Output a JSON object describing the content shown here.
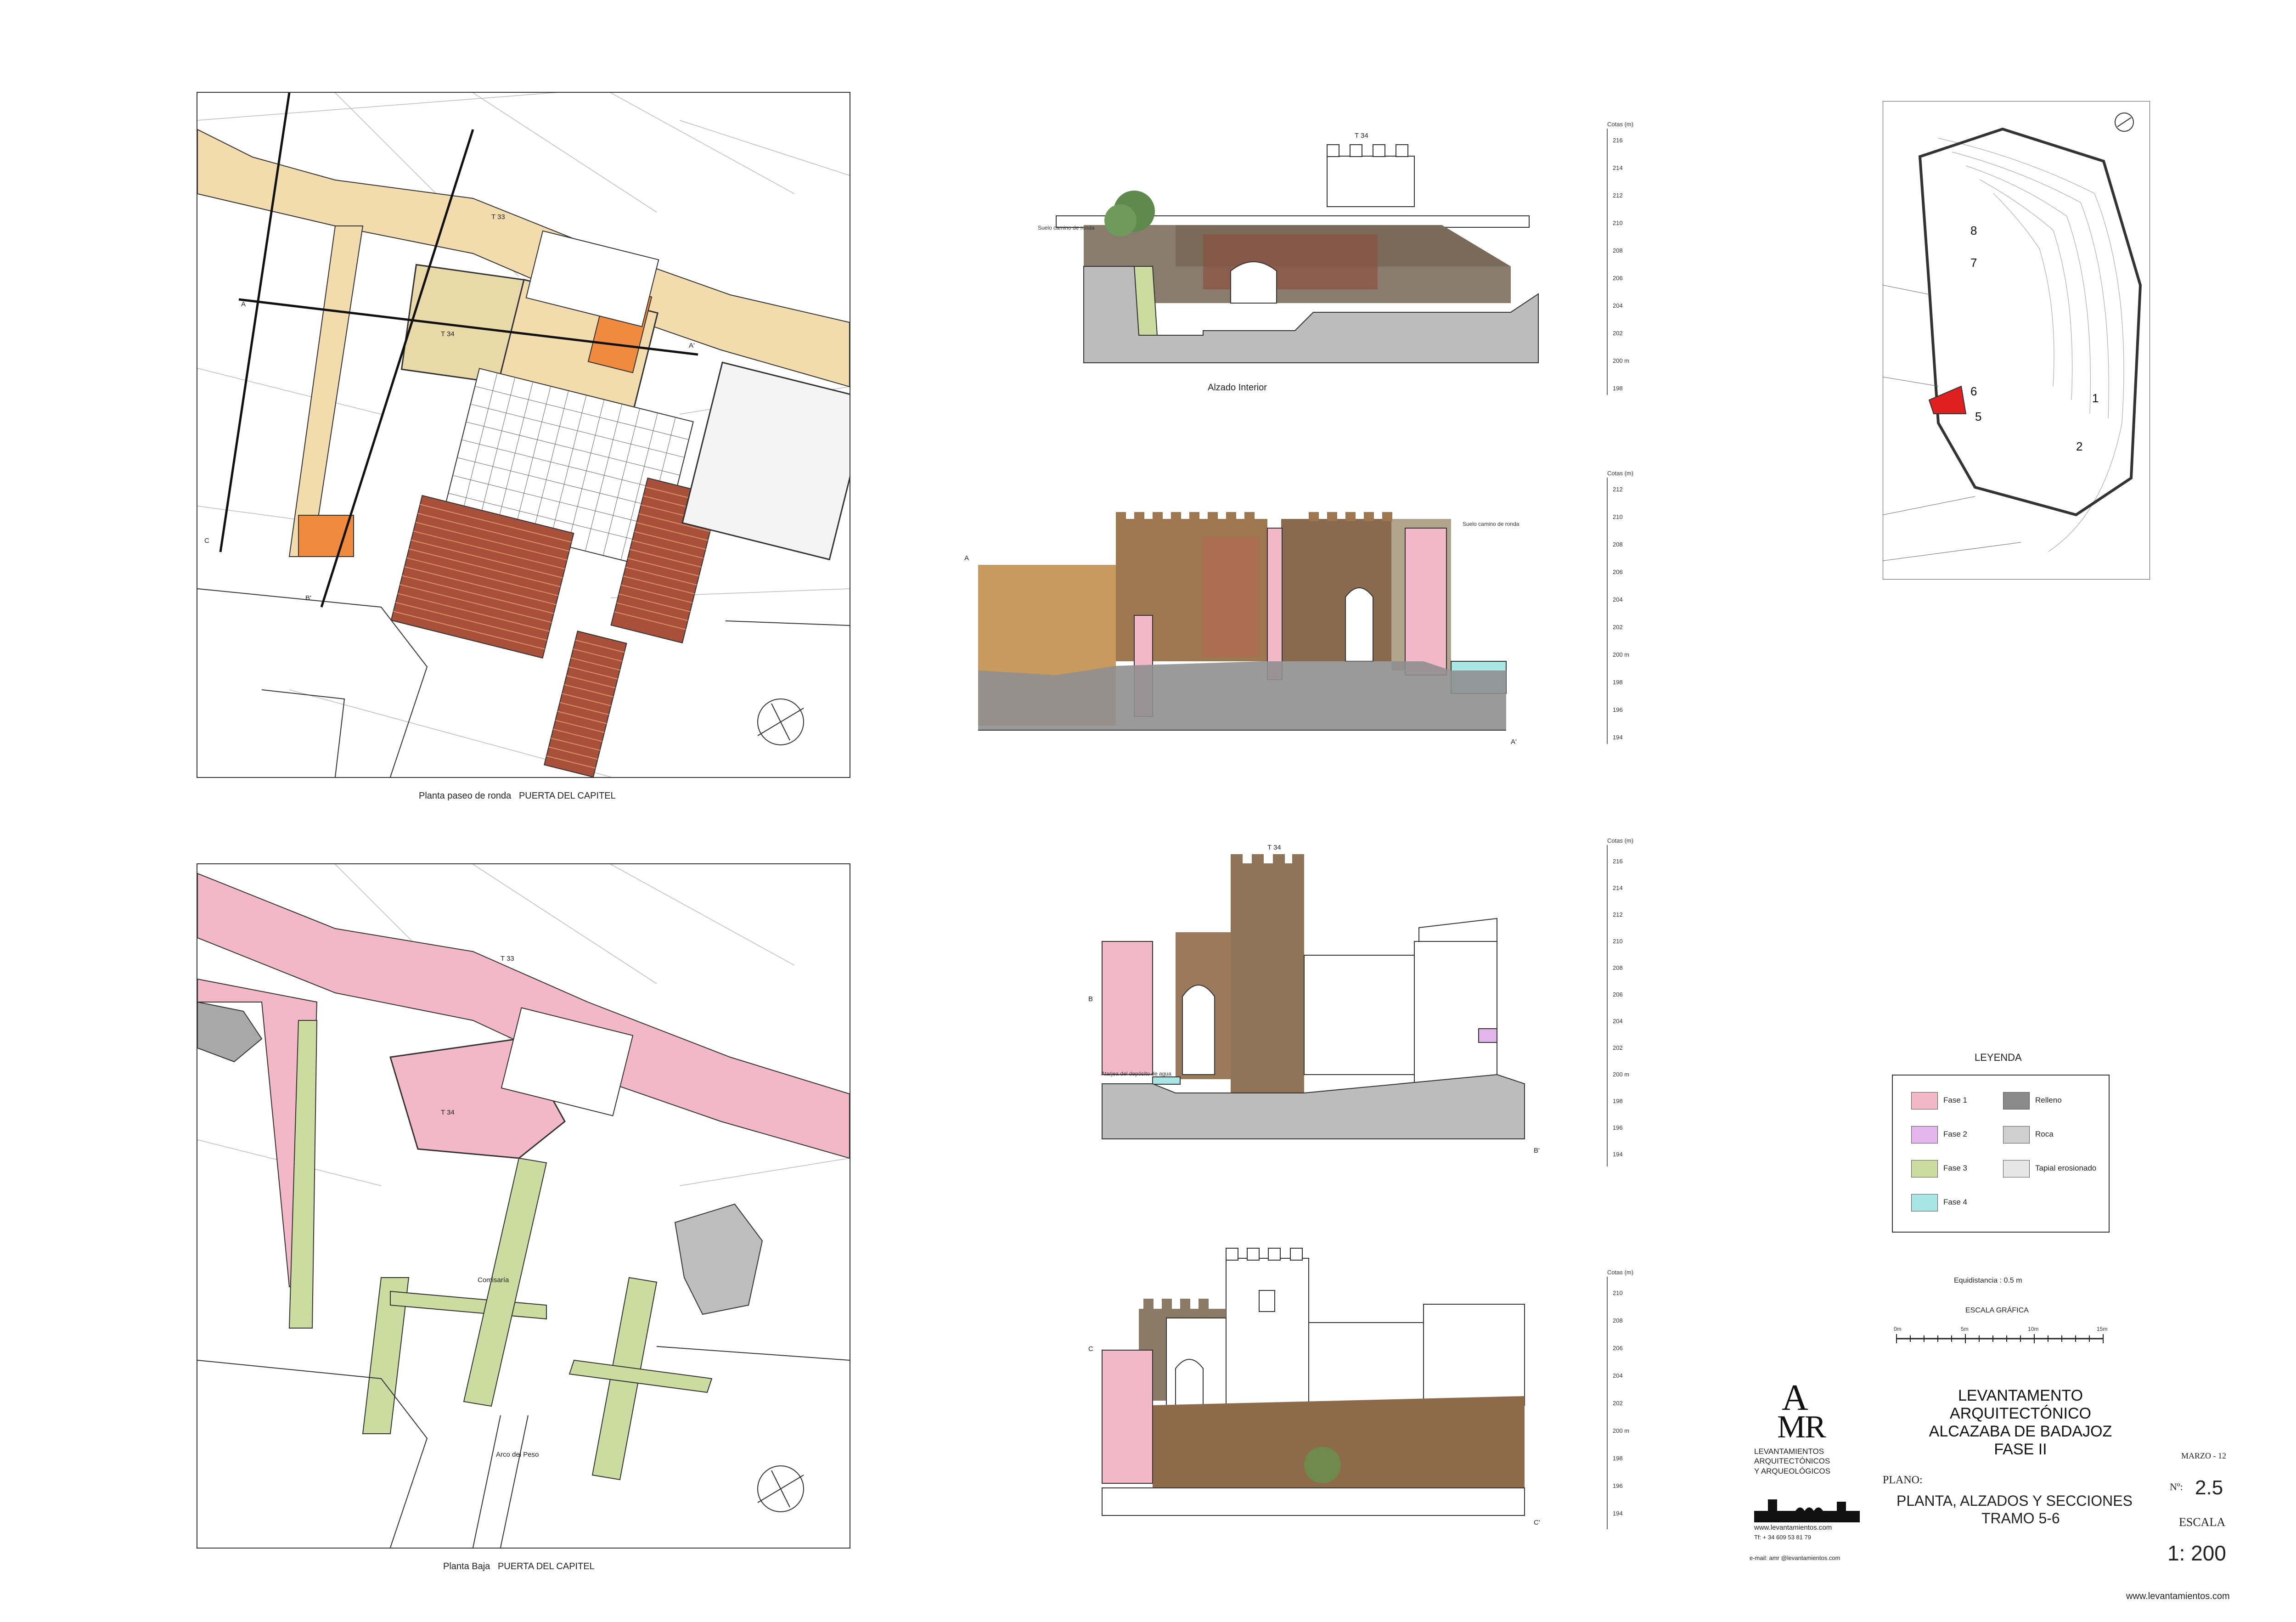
{
  "plans": {
    "top_caption": "Planta paseo de ronda   PUERTA DEL CAPITEL",
    "bottom_caption": "Planta Baja   PUERTA DEL CAPITEL",
    "top_labels": {
      "t33": "T 33",
      "t34": "T 34",
      "a": "A",
      "a2": "A'",
      "b2": "B'",
      "c": "C",
      "c2": "C'"
    },
    "bottom_labels": {
      "t33": "T 33",
      "t34": "T 34",
      "comisaria": "Comisaría",
      "arco": "Arco del Peso"
    }
  },
  "elevations": {
    "e1": {
      "tower_label": "T 34",
      "caption": "Alzado Interior",
      "note": "Suelo camino de ronda",
      "axis_title": "Cotas (m)",
      "ticks": [
        "216",
        "214",
        "212",
        "210",
        "208",
        "206",
        "204",
        "202",
        "200 m",
        "198"
      ]
    },
    "e2": {
      "left_label": "A",
      "right_label": "A'",
      "note": "Suelo camino de ronda",
      "axis_title": "Cotas (m)",
      "ticks": [
        "212",
        "210",
        "208",
        "206",
        "204",
        "202",
        "200 m",
        "198",
        "196",
        "194"
      ]
    },
    "e3": {
      "tower_label": "T 34",
      "left_label": "B",
      "right_label": "B'",
      "note": "Atarjea del depósito de agua",
      "axis_title": "Cotas (m)",
      "ticks": [
        "216",
        "214",
        "212",
        "210",
        "208",
        "206",
        "204",
        "202",
        "200 m",
        "198",
        "196",
        "194"
      ]
    },
    "e4": {
      "left_label": "C",
      "right_label": "C'",
      "axis_title": "Cotas (m)",
      "ticks": [
        "210",
        "208",
        "206",
        "204",
        "202",
        "200 m",
        "198",
        "196",
        "194"
      ]
    }
  },
  "keymap": {
    "markers": [
      "8",
      "7",
      "6",
      "5",
      "1",
      "2"
    ]
  },
  "legend": {
    "title": "LEYENDA",
    "items": [
      {
        "label": "Fase 1",
        "color": "#f2b8c8"
      },
      {
        "label": "Relleno",
        "color": "#8a8a8a"
      },
      {
        "label": "Fase 2",
        "color": "#e2b6ea"
      },
      {
        "label": "Roca",
        "color": "#cfcfcf"
      },
      {
        "label": "Fase 3",
        "color": "#cbdca0"
      },
      {
        "label": "Tapial erosionado",
        "color": "#e6e6e6"
      },
      {
        "label": "Fase 4",
        "color": "#a8e6e4"
      }
    ]
  },
  "scale": {
    "equidistance": "Equidistancia : 0.5 m",
    "graphic": "ESCALA  GRÁFICA",
    "ticks": [
      "0m",
      "5m",
      "10m",
      "15m"
    ]
  },
  "title_block": {
    "logo_text": "LEVANTAMIENTOS\nARQUITECTÓNICOS\nY ARQUEOLÓGICOS",
    "logo_url": "www.levantamientos.com",
    "logo_phone": "Tf: + 34 609 53 81 79",
    "logo_email": "e-mail: amr @levantamientos.com",
    "title1": "LEVANTAMENTO  ARQUITECTÓNICO",
    "title2": "ALCAZABA DE BADAJOZ",
    "title3": "FASE  II",
    "date": "MARZO - 12",
    "plano_label": "PLANO:",
    "plano1": "PLANTA, ALZADOS Y SECCIONES",
    "plano2": "TRAMO 5-6",
    "num_label": "Nº:",
    "num": "2.5",
    "escala_label": "ESCALA",
    "escala": "1: 200",
    "footer_url": "www.levantamientos.com"
  },
  "colors": {
    "fase1": "#f2b8c8",
    "fase2": "#e2b6ea",
    "fase3": "#cbdca0",
    "fase4": "#a8e6e4",
    "orange": "#f08a3c",
    "tan": "#f2dcae",
    "brick": "#a8503a"
  }
}
